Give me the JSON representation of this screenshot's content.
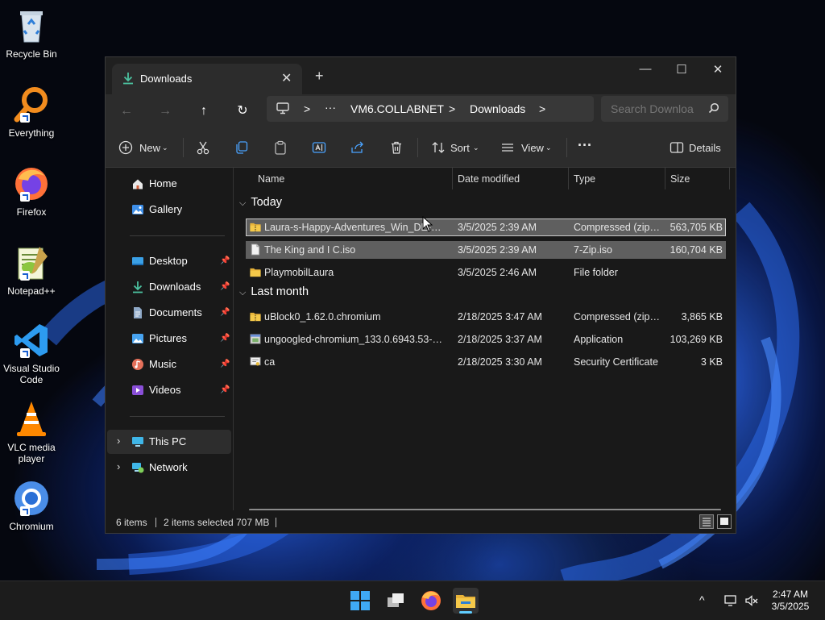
{
  "desktop": {
    "icons": [
      {
        "label": "Recycle Bin",
        "icon": "recycle-bin-icon"
      },
      {
        "label": "Everything",
        "icon": "everything-search-icon"
      },
      {
        "label": "Firefox",
        "icon": "firefox-icon"
      },
      {
        "label": "Notepad++",
        "icon": "notepad-plus-plus-icon"
      },
      {
        "label": "Visual Studio Code",
        "icon": "vscode-icon"
      },
      {
        "label": "VLC media player",
        "icon": "vlc-icon"
      },
      {
        "label": "Chromium",
        "icon": "chromium-icon"
      }
    ]
  },
  "window": {
    "tab_title": "Downloads",
    "tab_close": "✕",
    "new_tab": "+",
    "controls": {
      "minimize": "—",
      "maximize": "☐",
      "close": "✕"
    },
    "nav": {
      "back": "←",
      "forward": "→",
      "up": "↑",
      "refresh": "↻"
    },
    "breadcrumb": {
      "sep": ">",
      "more": "···",
      "items": [
        "VM6.COLLABNET",
        "Downloads"
      ]
    },
    "search": {
      "placeholder": "Search Downloa"
    },
    "toolbar": {
      "new_label": "New",
      "sort_label": "Sort",
      "view_label": "View",
      "more_label": "···",
      "details_label": "Details"
    },
    "sidebar": {
      "items": [
        {
          "label": "Home",
          "icon": "home-icon"
        },
        {
          "label": "Gallery",
          "icon": "gallery-icon"
        },
        {
          "label": "Desktop",
          "icon": "desktop-folder-icon",
          "pinned": true
        },
        {
          "label": "Downloads",
          "icon": "downloads-folder-icon",
          "pinned": true
        },
        {
          "label": "Documents",
          "icon": "documents-folder-icon",
          "pinned": true
        },
        {
          "label": "Pictures",
          "icon": "pictures-folder-icon",
          "pinned": true
        },
        {
          "label": "Music",
          "icon": "music-folder-icon",
          "pinned": true
        },
        {
          "label": "Videos",
          "icon": "videos-folder-icon",
          "pinned": true
        },
        {
          "label": "This PC",
          "icon": "this-pc-icon",
          "selected": true
        },
        {
          "label": "Network",
          "icon": "network-icon"
        }
      ]
    },
    "columns": {
      "name": "Name",
      "date": "Date modified",
      "type": "Type",
      "size": "Size"
    },
    "groups": [
      {
        "label": "Today",
        "files": [
          {
            "name": "Laura-s-Happy-Adventures_Win_DE-IN-...",
            "date": "3/5/2025 2:39 AM",
            "type": "Compressed (zipp...",
            "size": "563,705 KB",
            "icon": "zip-folder-icon",
            "selected": true
          },
          {
            "name": "The King and I C.iso",
            "date": "3/5/2025 2:39 AM",
            "type": "7-Zip.iso",
            "size": "160,704 KB",
            "icon": "iso-file-icon",
            "selected": true
          },
          {
            "name": "PlaymobilLaura",
            "date": "3/5/2025 2:46 AM",
            "type": "File folder",
            "size": "",
            "icon": "folder-icon",
            "selected": false
          }
        ]
      },
      {
        "label": "Last month",
        "files": [
          {
            "name": "uBlock0_1.62.0.chromium",
            "date": "2/18/2025 3:47 AM",
            "type": "Compressed (zipp...",
            "size": "3,865 KB",
            "icon": "zip-folder-icon",
            "selected": false
          },
          {
            "name": "ungoogled-chromium_133.0.6943.53-1.1...",
            "date": "2/18/2025 3:37 AM",
            "type": "Application",
            "size": "103,269 KB",
            "icon": "application-icon",
            "selected": false
          },
          {
            "name": "ca",
            "date": "2/18/2025 3:30 AM",
            "type": "Security Certificate",
            "size": "3 KB",
            "icon": "certificate-icon",
            "selected": false
          }
        ]
      }
    ],
    "status": {
      "items_count": "6 items",
      "selected": "2 items selected",
      "selected_size": "707 MB"
    }
  },
  "taskbar": {
    "apps": [
      "windows-start-icon",
      "task-view-icon",
      "firefox-icon",
      "file-explorer-icon"
    ],
    "tray_chevron": "^",
    "time": "2:47 AM",
    "date": "3/5/2025"
  },
  "colors": {
    "accent": "#60cdff",
    "folder": "#e8b339",
    "window_bg": "#191919",
    "toolbar_bg": "#2c2c2c",
    "selection": "#5f5f5f"
  }
}
